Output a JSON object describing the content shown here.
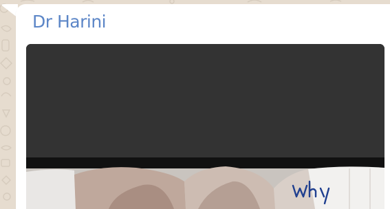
{
  "message": {
    "sender_name": "Dr Harini",
    "sender_name_color": "#5c86c7",
    "bubble_color": "#ffffff",
    "wallpaper_color": "#e6dccf"
  },
  "media": {
    "kind": "image",
    "dark_panel_color": "#333333",
    "divider_color": "#111111",
    "handwritten_text": "Why"
  }
}
